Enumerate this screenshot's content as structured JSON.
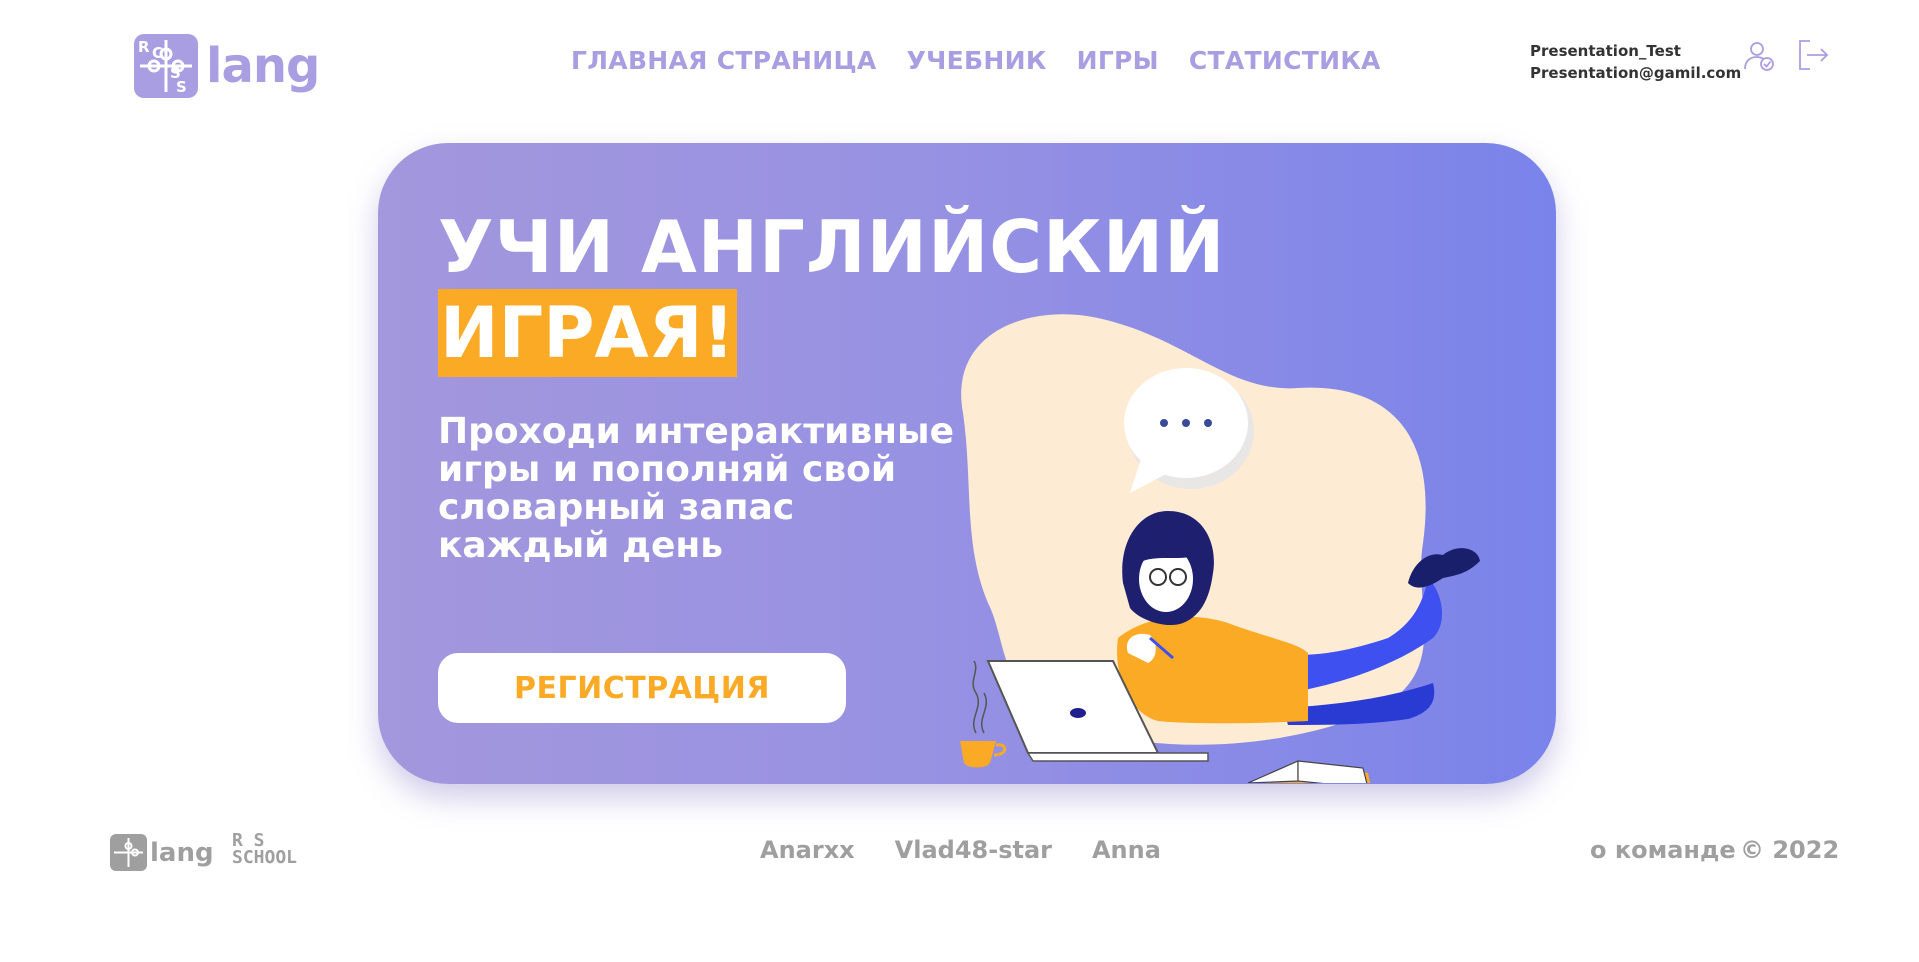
{
  "header": {
    "logo": {
      "mark": [
        "R",
        "C",
        "S",
        "S"
      ],
      "text": "lang"
    },
    "nav": [
      {
        "label": "ГЛАВНАЯ СТРАНИЦА"
      },
      {
        "label": "УЧЕБНИК"
      },
      {
        "label": "ИГРЫ"
      },
      {
        "label": "СТАТИСТИКА"
      }
    ],
    "user": {
      "name": "Presentation_Test",
      "email": "Presentation@gamil.com"
    },
    "icons": {
      "profile": "user-check-icon",
      "logout": "logout-icon"
    }
  },
  "hero": {
    "title_line1": "УЧИ АНГЛИЙСКИЙ",
    "title_line2": "ИГРАЯ!",
    "text": "Проходи интерактивные игры и пополняй свой словарный запас каждый день",
    "register_label": "РЕГИСТРАЦИЯ",
    "illustration": "girl-with-laptop-illustration",
    "colors": {
      "gradient_start": "#a397dd",
      "gradient_end": "#7a83ea",
      "accent": "#fbaa26",
      "highlight": "#fbaa26"
    }
  },
  "footer": {
    "logo_text": "lang",
    "rs_school": [
      "R S",
      "SCHOOL"
    ],
    "authors": [
      "Anarxx",
      "Vlad48-star",
      "Anna"
    ],
    "about": "о команде",
    "copyright": "© 2022"
  }
}
